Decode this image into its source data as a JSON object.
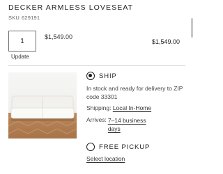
{
  "product": {
    "title": "DECKER ARMLESS LOVESEAT",
    "sku_label": "SKU",
    "sku_number": "629191",
    "image_alt": "White armless loveseat on herringbone wood floor"
  },
  "quantity": {
    "value": "1",
    "update_label": "Update"
  },
  "pricing": {
    "unit_price": "$1,549.00",
    "total_price": "$1,549.00"
  },
  "delivery": {
    "ship": {
      "label": "SHIP",
      "selected": true,
      "stock_text": "In stock and ready for delivery to ZIP code 33301",
      "shipping_label": "Shipping:",
      "shipping_method": "Local In-Home",
      "arrives_label": "Arrives:",
      "arrives_value": "7–14 business days"
    },
    "pickup": {
      "label": "FREE PICKUP",
      "selected": false,
      "select_location": "Select location"
    }
  },
  "colors": {
    "text": "#222222",
    "muted": "#666666",
    "border": "#6d6d6d",
    "divider": "#d6d6d6"
  }
}
